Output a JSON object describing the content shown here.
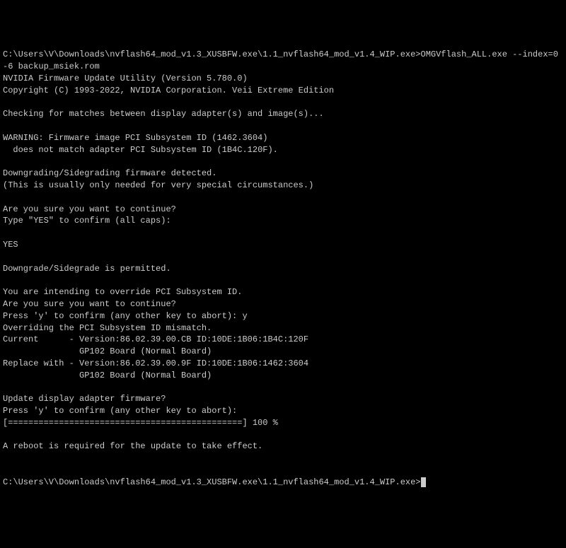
{
  "terminal": {
    "lines": [
      "C:\\Users\\V\\Downloads\\nvflash64_mod_v1.3_XUSBFW.exe\\1.1_nvflash64_mod_v1.4_WIP.exe>OMGVflash_ALL.exe --index=0 -6 backup_msiek.rom",
      "NVIDIA Firmware Update Utility (Version 5.780.0)",
      "Copyright (C) 1993-2022, NVIDIA Corporation. Veii Extreme Edition",
      "",
      "Checking for matches between display adapter(s) and image(s)...",
      "",
      "WARNING: Firmware image PCI Subsystem ID (1462.3604)",
      "  does not match adapter PCI Subsystem ID (1B4C.120F).",
      "",
      "Downgrading/Sidegrading firmware detected.",
      "(This is usually only needed for very special circumstances.)",
      "",
      "Are you sure you want to continue?",
      "Type \"YES\" to confirm (all caps):",
      "",
      "YES",
      "",
      "Downgrade/Sidegrade is permitted.",
      "",
      "You are intending to override PCI Subsystem ID.",
      "Are you sure you want to continue?",
      "Press 'y' to confirm (any other key to abort): y",
      "Overriding the PCI Subsystem ID mismatch.",
      "Current      - Version:86.02.39.00.CB ID:10DE:1B06:1B4C:120F",
      "               GP102 Board (Normal Board)",
      "Replace with - Version:86.02.39.00.9F ID:10DE:1B06:1462:3604",
      "               GP102 Board (Normal Board)",
      "",
      "Update display adapter firmware?",
      "Press 'y' to confirm (any other key to abort):",
      "[==============================================] 100 %",
      "",
      "A reboot is required for the update to take effect.",
      "",
      ""
    ],
    "prompt": "C:\\Users\\V\\Downloads\\nvflash64_mod_v1.3_XUSBFW.exe\\1.1_nvflash64_mod_v1.4_WIP.exe>"
  }
}
